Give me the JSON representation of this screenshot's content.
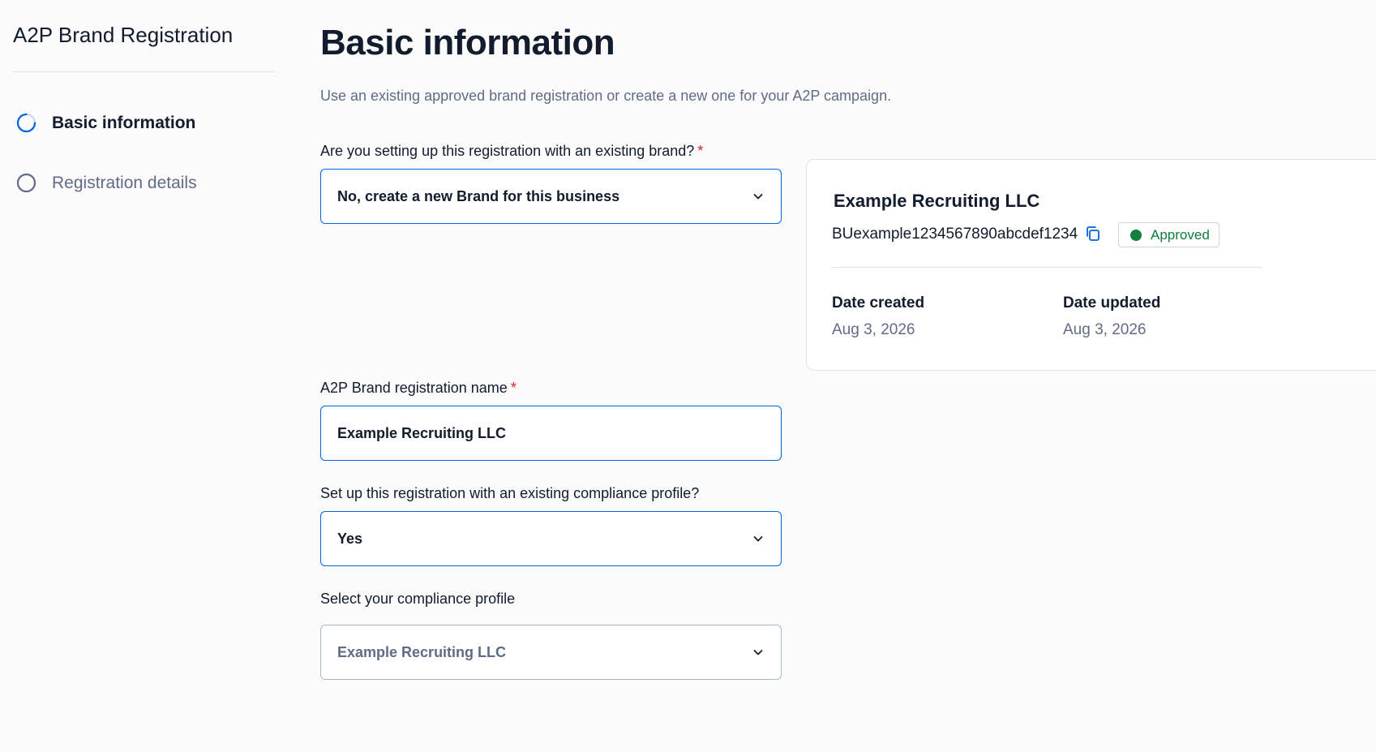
{
  "sidebar": {
    "title": "A2P Brand Registration",
    "steps": [
      {
        "label": "Basic information",
        "state": "in-progress"
      },
      {
        "label": "Registration details",
        "state": "not-started"
      }
    ]
  },
  "main": {
    "title": "Basic information",
    "subtitle": "Use an existing approved brand registration or create a new one for your A2P campaign.",
    "fields": [
      {
        "label": "Are you setting up this registration with an existing brand?",
        "required": "*",
        "value": "No, create a new Brand for this business",
        "type": "select"
      },
      {
        "label": "A2P Brand registration name",
        "required": "*",
        "value": "Example Recruiting LLC",
        "type": "text"
      },
      {
        "label": "Set up this registration with an existing compliance profile?",
        "value": "Yes",
        "type": "select"
      },
      {
        "label": "Select your compliance profile",
        "value": "Example Recruiting LLC",
        "type": "select"
      }
    ]
  },
  "brand_card": {
    "name": "Example Recruiting LLC",
    "brand_id": "BUexample1234567890abcdef1234",
    "status": "Approved",
    "date_created_label": "Date created",
    "date_created": "Aug 3, 2026",
    "date_updated_label": "Date updated",
    "date_updated": "Aug 3, 2026"
  },
  "colors": {
    "accent": "#0263e0",
    "required": "#d61f1f",
    "success": "#14803c",
    "text_primary": "#121c2d",
    "text_muted": "#606b85"
  },
  "icons": {
    "step_in_progress": "progress-circle-icon",
    "step_pending": "empty-circle-icon",
    "dropdown": "chevron-down-icon",
    "copy": "copy-icon",
    "status": "status-dot-icon"
  }
}
